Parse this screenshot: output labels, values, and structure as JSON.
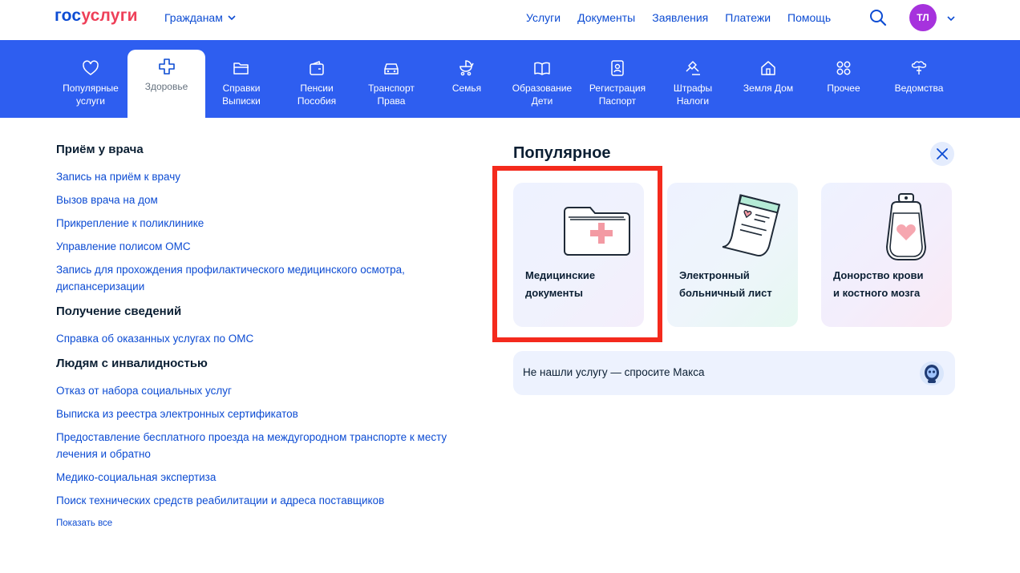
{
  "header": {
    "logo_part1": "гос",
    "logo_part2": "услуги",
    "audience": "Гражданам",
    "nav": [
      "Услуги",
      "Документы",
      "Заявления",
      "Платежи",
      "Помощь"
    ],
    "avatar_initials": "ТЛ",
    "icons": {
      "search": "search-icon",
      "chevron": "chevron-down-icon"
    }
  },
  "categories": [
    {
      "line1": "Популярные",
      "line2": "услуги",
      "icon": "heart-icon"
    },
    {
      "line1": "Здоровье",
      "line2": "",
      "icon": "medical-cross-icon",
      "active": true
    },
    {
      "line1": "Справки",
      "line2": "Выписки",
      "icon": "folder-icon"
    },
    {
      "line1": "Пенсии",
      "line2": "Пособия",
      "icon": "wallet-icon"
    },
    {
      "line1": "Транспорт",
      "line2": "Права",
      "icon": "car-icon"
    },
    {
      "line1": "Семья",
      "line2": "",
      "icon": "stroller-icon"
    },
    {
      "line1": "Образование",
      "line2": "Дети",
      "icon": "book-icon"
    },
    {
      "line1": "Регистрация",
      "line2": "Паспорт",
      "icon": "passport-icon"
    },
    {
      "line1": "Штрафы",
      "line2": "Налоги",
      "icon": "gavel-icon"
    },
    {
      "line1": "Земля Дом",
      "line2": "",
      "icon": "house-icon"
    },
    {
      "line1": "Прочее",
      "line2": "",
      "icon": "grid-icon"
    },
    {
      "line1": "Ведомства",
      "line2": "",
      "icon": "emblem-icon"
    }
  ],
  "sections": [
    {
      "title": "Приём у врача",
      "links": [
        "Запись на приём к врачу",
        "Вызов врача на дом",
        "Прикрепление к поликлинике",
        "Управление полисом ОМС",
        "Запись для прохождения профилактического медицинского осмотра, диспансеризации"
      ]
    },
    {
      "title": "Получение сведений",
      "links": [
        "Справка об оказанных услугах по ОМС"
      ]
    },
    {
      "title": "Людям с инвалидностью",
      "links": [
        "Отказ от набора социальных услуг",
        "Выписка из реестра электронных сертификатов",
        "Предоставление бесплатного проезда на междугородном транспорте к месту лечения и обратно",
        "Медико-социальная экспертиза",
        "Поиск технических средств реабилитации и адреса поставщиков"
      ]
    }
  ],
  "show_all": "Показать все",
  "popular": {
    "title": "Популярное",
    "cards": [
      {
        "line1": "Медицинские",
        "line2": "документы",
        "icon": "medical-folder-icon"
      },
      {
        "line1": "Электронный",
        "line2": "больничный лист",
        "icon": "sick-leave-icon"
      },
      {
        "line1": "Донорство крови",
        "line2": "и костного мозга",
        "icon": "blood-bag-icon"
      }
    ],
    "ask": "Не нашли услугу — спросите Макса"
  },
  "colors": {
    "brand_blue": "#0d4cd3",
    "brand_red": "#ee3f58",
    "category_bar": "#2e5ef0",
    "avatar": "#a632dd",
    "highlight": "#f42a1d"
  }
}
